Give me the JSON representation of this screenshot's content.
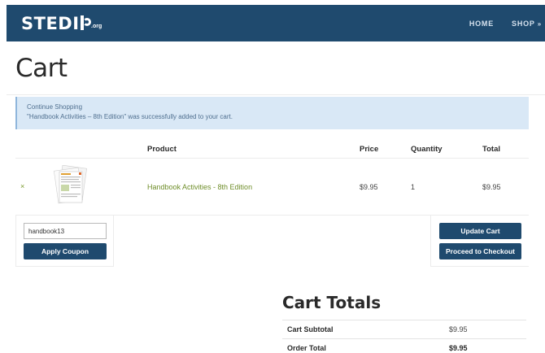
{
  "header": {
    "logo_text": "STEDI",
    "logo_suffix": ".org",
    "nav": [
      {
        "label": "HOME"
      },
      {
        "label": "SHOP",
        "chevron": "»"
      }
    ],
    "colors": {
      "bar": "#1f4a6e",
      "button": "#1f4a6e",
      "link": "#6f8e2a"
    }
  },
  "page": {
    "title": "Cart"
  },
  "notice": {
    "link": "Continue Shopping",
    "message": "\"Handbook Activities – 8th Edition\" was successfully added to your cart."
  },
  "table": {
    "headers": {
      "product": "Product",
      "price": "Price",
      "quantity": "Quantity",
      "total": "Total"
    },
    "rows": [
      {
        "remove": "×",
        "thumbnail_icon": "book-thumbnail-icon",
        "product": "Handbook Activities - 8th Edition",
        "price": "$9.95",
        "quantity": "1",
        "total": "$9.95"
      }
    ]
  },
  "coupon": {
    "value": "handbook13",
    "apply_label": "Apply Coupon"
  },
  "actions": {
    "update_label": "Update Cart",
    "checkout_label": "Proceed to Checkout"
  },
  "totals": {
    "title": "Cart Totals",
    "rows": [
      {
        "label": "Cart Subtotal",
        "value": "$9.95"
      },
      {
        "label": "Order Total",
        "value": "$9.95"
      }
    ]
  }
}
